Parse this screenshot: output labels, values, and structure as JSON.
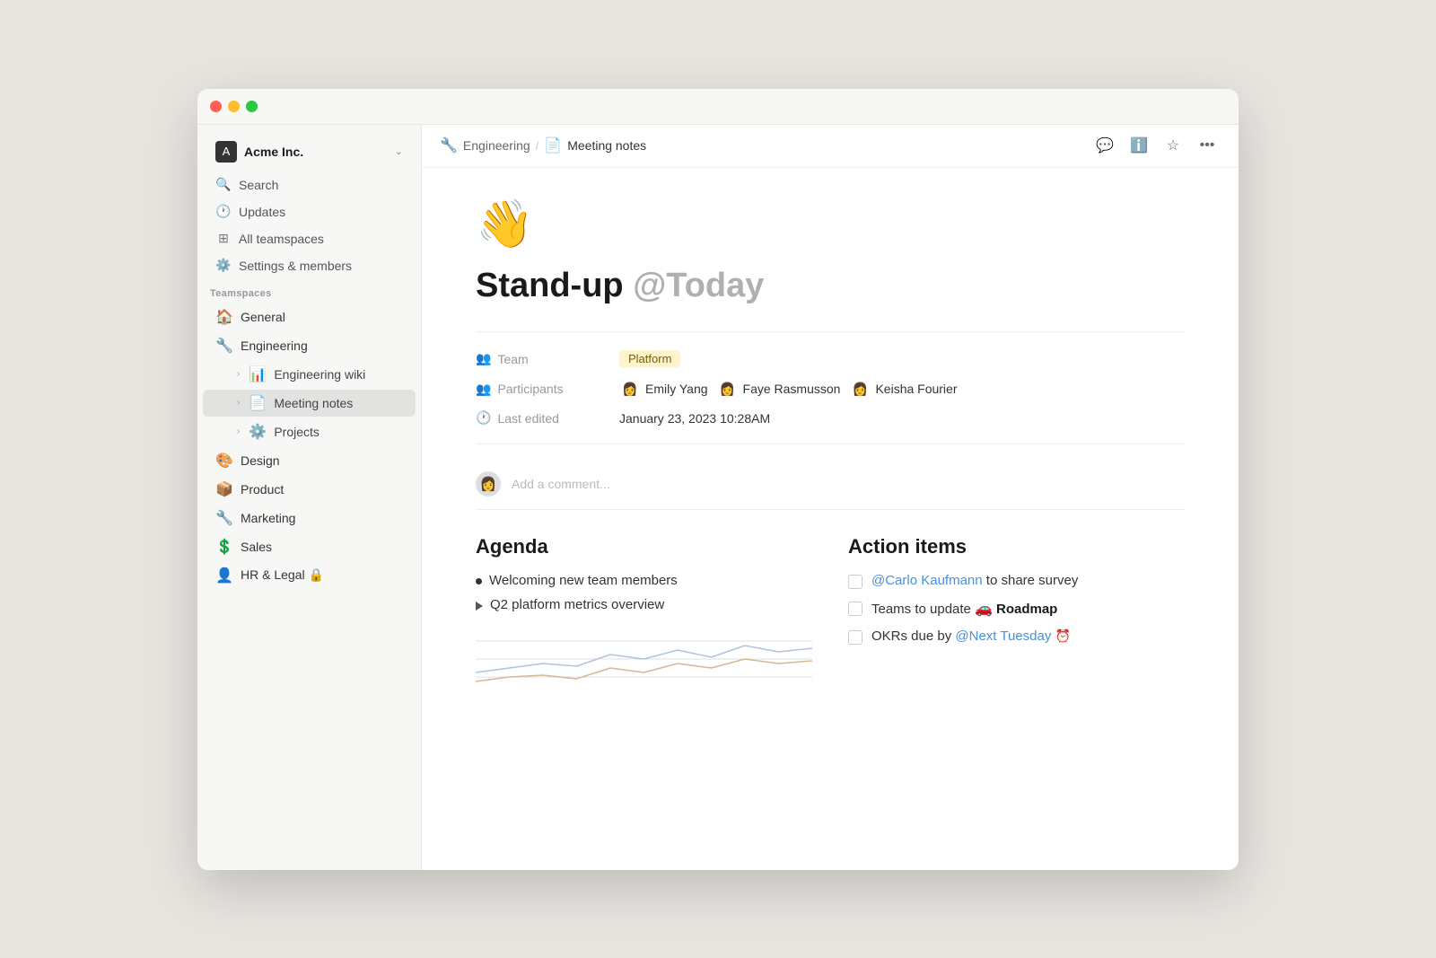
{
  "window": {
    "title": "Meeting notes"
  },
  "sidebar": {
    "workspace_name": "Acme Inc.",
    "nav_items": [
      {
        "id": "search",
        "label": "Search",
        "icon": "🔍"
      },
      {
        "id": "updates",
        "label": "Updates",
        "icon": "🕐"
      },
      {
        "id": "teamspaces",
        "label": "All teamspaces",
        "icon": "⊞"
      },
      {
        "id": "settings",
        "label": "Settings & members",
        "icon": "⚙️"
      }
    ],
    "section_label": "Teamspaces",
    "teamspace_items": [
      {
        "id": "general",
        "label": "General",
        "icon": "🏠"
      },
      {
        "id": "engineering",
        "label": "Engineering",
        "icon": "🔧"
      },
      {
        "id": "engineering-wiki",
        "label": "Engineering wiki",
        "icon": "📊",
        "indent": true
      },
      {
        "id": "meeting-notes",
        "label": "Meeting notes",
        "icon": "📄",
        "indent": true,
        "active": true
      },
      {
        "id": "projects",
        "label": "Projects",
        "icon": "⚙️",
        "indent": true
      },
      {
        "id": "design",
        "label": "Design",
        "icon": "🎨"
      },
      {
        "id": "product",
        "label": "Product",
        "icon": "📦"
      },
      {
        "id": "marketing",
        "label": "Marketing",
        "icon": "🔧"
      },
      {
        "id": "sales",
        "label": "Sales",
        "icon": "💲"
      },
      {
        "id": "hr-legal",
        "label": "HR & Legal 🔒",
        "icon": "👤"
      }
    ]
  },
  "breadcrumb": {
    "parent_icon": "🔧",
    "parent_label": "Engineering",
    "current_icon": "📄",
    "current_label": "Meeting notes"
  },
  "topbar_actions": {
    "comment_icon": "💬",
    "info_icon": "ℹ️",
    "star_icon": "☆",
    "more_icon": "•••"
  },
  "page": {
    "emoji": "👋",
    "title": "Stand-up",
    "title_ref": "@Today",
    "properties": {
      "team_label": "Team",
      "team_icon": "👥",
      "team_value": "Platform",
      "participants_label": "Participants",
      "participants_icon": "👥",
      "participants": [
        {
          "name": "Emily Yang",
          "avatar": "👩"
        },
        {
          "name": "Faye Rasmusson",
          "avatar": "👩"
        },
        {
          "name": "Keisha Fourier",
          "avatar": "👩"
        }
      ],
      "last_edited_label": "Last edited",
      "last_edited_icon": "🕐",
      "last_edited_value": "January 23, 2023 10:28AM"
    },
    "comment_placeholder": "Add a comment...",
    "agenda": {
      "title": "Agenda",
      "items": [
        {
          "type": "bullet",
          "text": "Welcoming new team members"
        },
        {
          "type": "triangle",
          "text": "Q2 platform metrics overview"
        }
      ]
    },
    "action_items": {
      "title": "Action items",
      "items": [
        {
          "text_before": "",
          "mention": "@Carlo Kaufmann",
          "text_after": " to share survey"
        },
        {
          "text_before": "Teams to update ",
          "mention": "",
          "text_after": " Roadmap",
          "has_roadmap": true
        },
        {
          "text_before": "OKRs due by ",
          "mention": "@Next Tuesday",
          "text_after": "",
          "has_alarm": true
        }
      ]
    }
  }
}
